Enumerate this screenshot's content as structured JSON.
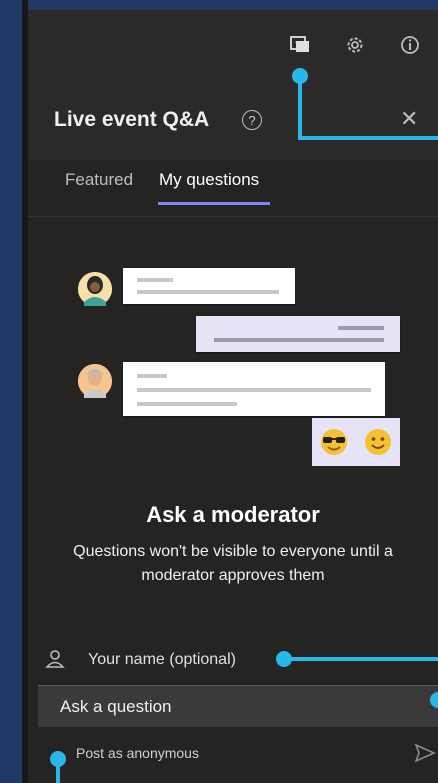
{
  "header": {
    "title": "Live event Q&A",
    "help_glyph": "?",
    "close_glyph": "✕",
    "toolbar_icons": [
      "qna-icon",
      "gear-icon",
      "info-icon"
    ]
  },
  "tabs": [
    {
      "label": "Featured",
      "active": false
    },
    {
      "label": "My questions",
      "active": true
    }
  ],
  "empty_state": {
    "title": "Ask a moderator",
    "description": "Questions won't be visible to everyone until a moderator approves them"
  },
  "form": {
    "name_placeholder": "Your name (optional)",
    "question_placeholder": "Ask a question",
    "anonymous_label": "Post as anonymous"
  },
  "colors": {
    "background": "#1f3864",
    "panel": "#252423",
    "accent": "#7f85f5",
    "callout": "#29b6e8"
  }
}
